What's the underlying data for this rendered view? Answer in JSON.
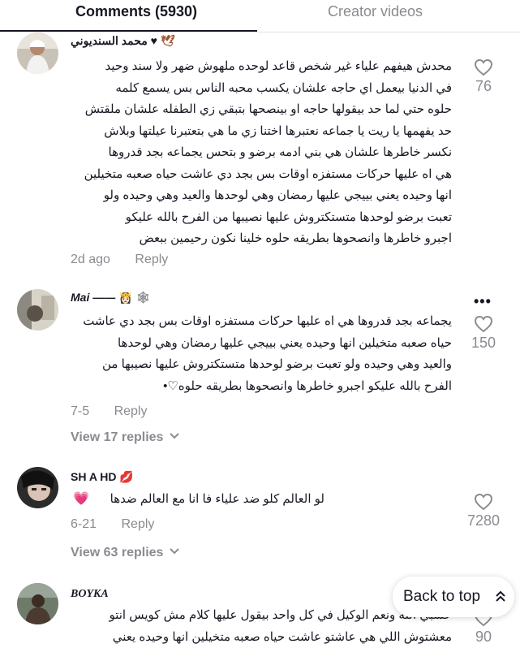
{
  "tabs": {
    "comments": "Comments (5930)",
    "creator": "Creator videos"
  },
  "comments": [
    {
      "username": "محمد السنديوني ♥",
      "lines": [
        "محدش هيفهم علياء غير شخص قاعد لوحده ملهوش ضهر ولا سند وحيد",
        "في الدنيا بيعمل اي حاجه علشان يكسب محبه الناس بس يسمع كلمه",
        "حلوه حتي لما حد بيقولها حاجه او بينصحها بتبقي زي الطفله علشان ملقتش",
        "حد يفهمها يا ريت يا جماعه نعتبرها اختنا زي ما هي بتعتبرنا عيلتها وبلاش",
        "نكسر خاطرها علشان هي بني ادمه برضو و بتحس يجماعه بجد قدروها",
        "هي اه عليها حركات مستفزه اوقات بس بجد دي عاشت حياه صعبه متخيلين",
        "انها وحيده يعني بييجي عليها رمضان وهي لوحدها والعيد وهي وحيده ولو",
        "تعبت برضو لوحدها متستكتروش عليها نصيبها من الفرح بالله عليكو",
        "اجبرو خاطرها وانصحوها بطريقه حلوه خلينا نكون رحيمين ببعض"
      ],
      "date": "2d ago",
      "reply": "Reply",
      "likes": "76"
    },
    {
      "username": "Mai ——",
      "lines": [
        "يجماعه بجد قدروها هي اه عليها حركات مستفزه اوقات بس بجد دي عاشت",
        "حياه صعبه متخيلين انها وحيده يعني بييجي عليها رمضان وهي لوحدها",
        "والعيد وهي وحيده ولو تعبت برضو لوحدها متستكتروش عليها نصيبها من",
        "الفرح بالله عليكو اجبرو خاطرها وانصحوها بطريقه حلوه♡•"
      ],
      "date": "7-5",
      "reply": "Reply",
      "likes": "150",
      "more": "•••",
      "view_replies": "View 17 replies"
    },
    {
      "username": "SH A HD",
      "lines": [
        "لو العالم كلو ضد علياء فا انا مع العالم ضدها"
      ],
      "date": "6-21",
      "reply": "Reply",
      "likes": "7280",
      "view_replies": "View 63 replies"
    },
    {
      "username": "BOYKA",
      "lines": [
        "حسبي الله ونعم الوكيل في كل واحد بيقول عليها كلام مش كويس انتو",
        "معشتوش اللي هي عاشتو عاشت حياه صعبه متخيلين انها وحيده يعني"
      ],
      "likes": "90"
    }
  ],
  "back_to_top": "Back to top",
  "colors": {
    "text": "#161823",
    "secondary": "#8a8b91",
    "heart_emoji": "#fe2c55"
  }
}
